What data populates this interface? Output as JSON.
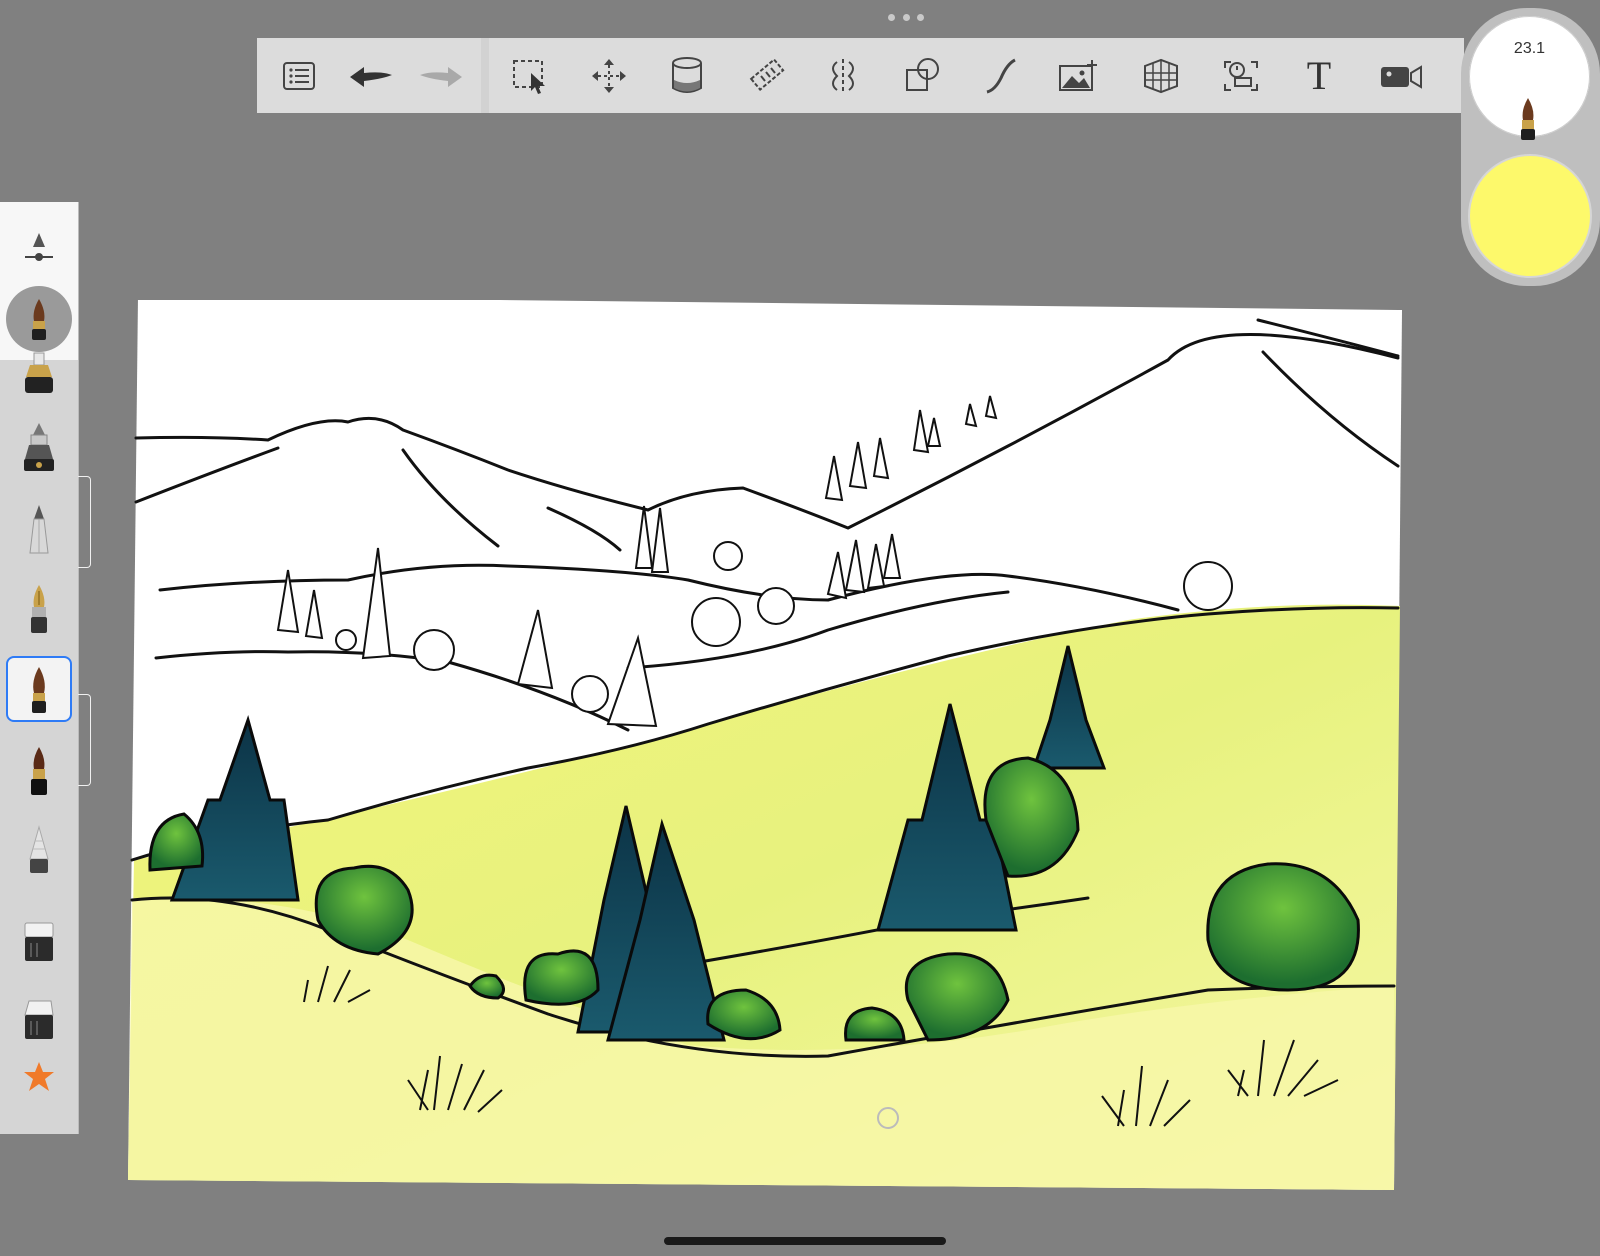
{
  "toolbar": {
    "items": [
      {
        "name": "layers-list-button",
        "icon": "list-icon"
      },
      {
        "name": "undo-button",
        "icon": "undo-icon"
      },
      {
        "name": "redo-button",
        "icon": "redo-icon"
      },
      {
        "name": "selection-button",
        "icon": "selection-icon"
      },
      {
        "name": "transform-button",
        "icon": "move-icon"
      },
      {
        "name": "fill-button",
        "icon": "paint-bucket-icon"
      },
      {
        "name": "ruler-button",
        "icon": "ruler-icon"
      },
      {
        "name": "symmetry-button",
        "icon": "symmetry-icon"
      },
      {
        "name": "shapes-button",
        "icon": "shapes-icon"
      },
      {
        "name": "stroke-button",
        "icon": "curve-icon"
      },
      {
        "name": "add-image-button",
        "icon": "image-add-icon"
      },
      {
        "name": "perspective-button",
        "icon": "perspective-grid-icon"
      },
      {
        "name": "time-lapse-button",
        "icon": "timelapse-icon"
      },
      {
        "name": "text-button",
        "icon": "text-icon",
        "label": "T"
      },
      {
        "name": "record-button",
        "icon": "video-icon"
      }
    ]
  },
  "brush_panel": {
    "size_value": "23.1",
    "current_color": "#fdf96b"
  },
  "brush_library": {
    "items": [
      {
        "name": "brush-settings",
        "icon": "brush-settings-icon"
      },
      {
        "name": "current-brush",
        "icon": "paintbrush-icon"
      },
      {
        "name": "brush-marker",
        "icon": "marker-icon"
      },
      {
        "name": "brush-airbrush",
        "icon": "airbrush-icon"
      },
      {
        "name": "brush-pencil",
        "icon": "pencil-icon"
      },
      {
        "name": "brush-fountain-pen",
        "icon": "fountain-pen-icon"
      },
      {
        "name": "brush-paintbrush",
        "icon": "paintbrush-icon",
        "selected": true
      },
      {
        "name": "brush-ink-pen",
        "icon": "ink-pen-icon"
      },
      {
        "name": "brush-cone",
        "icon": "cone-brush-icon"
      },
      {
        "name": "brush-eraser-soft",
        "icon": "eraser-icon"
      },
      {
        "name": "brush-eraser-hard",
        "icon": "eraser-icon"
      },
      {
        "name": "brush-favorites",
        "icon": "star-icon"
      }
    ]
  },
  "colors": {
    "background": "#808080",
    "toolbar": "#dcdcdc",
    "selection_accent": "#2e7bf6",
    "meadow_yellow": "#f6f79a",
    "tree_dark": "#0f3b4f",
    "bush_green": "#2f8a3a",
    "star_orange": "#f07a2a"
  }
}
